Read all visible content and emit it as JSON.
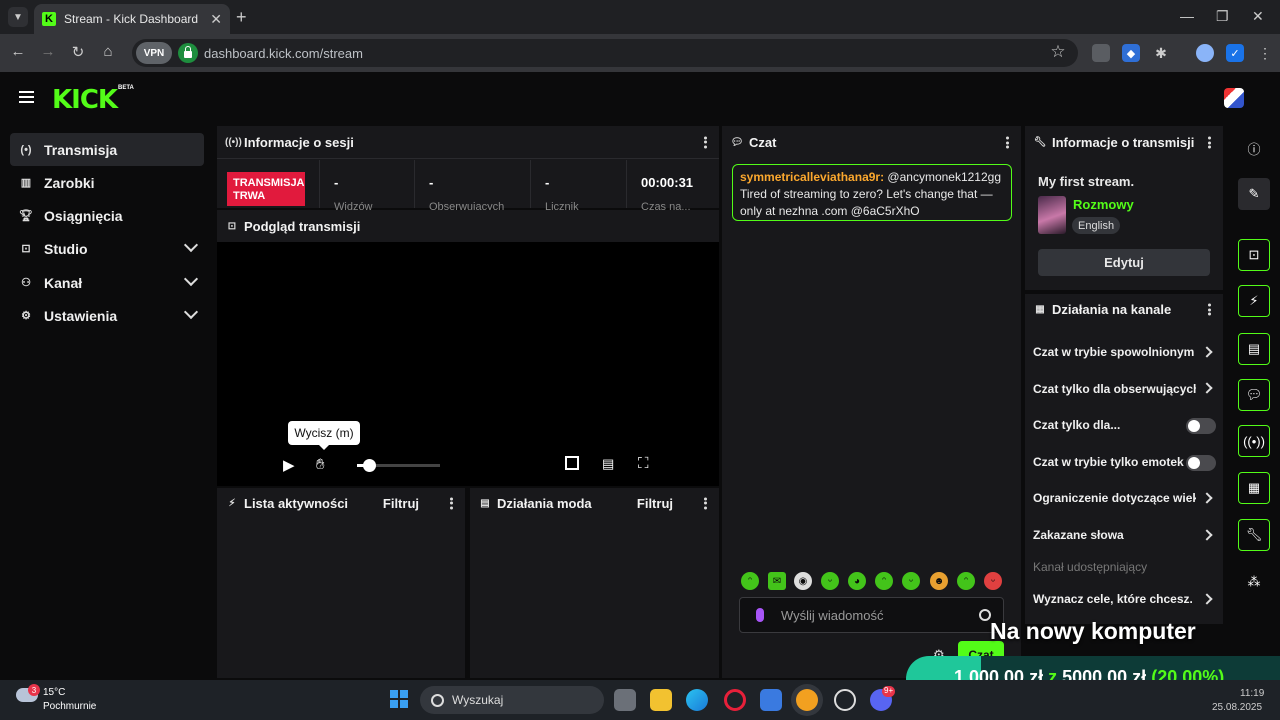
{
  "browser": {
    "tab_title": "Stream - Kick Dashboard",
    "url": "dashboard.kick.com/stream",
    "vpn_label": "VPN"
  },
  "app": {
    "logo": "KICK",
    "beta": "BETA",
    "accent": "#53fc18"
  },
  "sidebar": {
    "items": [
      {
        "label": "Transmisja",
        "icon": "broadcast-icon"
      },
      {
        "label": "Zarobki",
        "icon": "earnings-icon"
      },
      {
        "label": "Osiągnięcia",
        "icon": "trophy-icon"
      },
      {
        "label": "Studio",
        "icon": "studio-icon"
      },
      {
        "label": "Kanał",
        "icon": "channel-icon"
      },
      {
        "label": "Ustawienia",
        "icon": "settings-icon"
      }
    ]
  },
  "session": {
    "title": "Informacje o sesji",
    "live_badge_line1": "TRANSMISJA",
    "live_badge_line2": "TRWA",
    "stats": [
      {
        "value": "-",
        "label": "Widzów"
      },
      {
        "value": "-",
        "label": "Obserwujących"
      },
      {
        "value": "-",
        "label": "Licznik"
      },
      {
        "value": "00:00:31",
        "label": "Czas na..."
      }
    ]
  },
  "preview": {
    "title": "Podgląd transmisji",
    "mute_tooltip": "Wycisz (m)",
    "volume_fraction": 0.15
  },
  "activity": {
    "title": "Lista aktywności",
    "filter": "Filtruj"
  },
  "modactions": {
    "title": "Działania moda",
    "filter": "Filtruj"
  },
  "chat": {
    "title": "Czat",
    "message": {
      "user": "symmetricalleviathana9r:",
      "text": " @ancymonek1212gg Tired of streaming to zero? Let's change that — only at nezhna .com @6aC5rXhO"
    },
    "input_placeholder": "Wyślij wiadomość",
    "send_label": "Czat"
  },
  "stream_info": {
    "title": "Informacje o transmisji",
    "stream_title": "My first stream.",
    "category": "Rozmowy",
    "language": "English",
    "edit_label": "Edytuj"
  },
  "channel_actions": {
    "title": "Działania na kanale",
    "items": [
      {
        "label": "Czat w trybie spowolnionym",
        "type": "chevron"
      },
      {
        "label": "Czat tylko dla obserwujących",
        "type": "chevron"
      },
      {
        "label": "Czat tylko dla...",
        "type": "toggle"
      },
      {
        "label": "Czat w trybie tylko emotek",
        "type": "toggle"
      },
      {
        "label": "Ograniczenie dotyczące wieku",
        "type": "chevron"
      },
      {
        "label": "Zakazane słowa",
        "type": "chevron"
      },
      {
        "label": "Kanał udostępniający",
        "type": "disabled"
      },
      {
        "label": "Wyznacz cele, które chcesz...",
        "type": "chevron"
      }
    ]
  },
  "goal": {
    "title": "Na nowy komputer",
    "current": "1 000,00 zł",
    "separator": "z",
    "target": "5000,00 zł",
    "percent": "(20.00%)",
    "progress": 0.2
  },
  "taskbar": {
    "temperature": "15°C",
    "weather": "Pochmurnie",
    "weather_badge": "3",
    "search": "Wyszukaj",
    "time": "11:19",
    "date": "25.08.2025",
    "discord_badge": "9+"
  }
}
